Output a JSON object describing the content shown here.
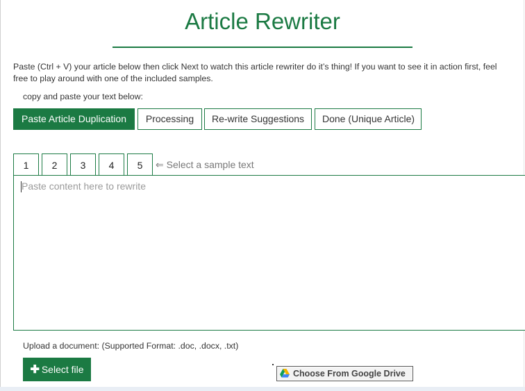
{
  "header": {
    "title": "Article Rewriter"
  },
  "intro": {
    "text": "Paste (Ctrl + V) your article below then click Next to watch this article rewriter do it’s thing! If you want to see it in action first, feel free to play around with one of the included samples.",
    "copy_label": "copy and paste your text below:"
  },
  "steps": [
    {
      "label": "Paste Article Duplication",
      "active": true
    },
    {
      "label": "Processing",
      "active": false
    },
    {
      "label": "Re-write Suggestions",
      "active": false
    },
    {
      "label": "Done (Unique Article)",
      "active": false
    }
  ],
  "samples": {
    "tabs": [
      "1",
      "2",
      "3",
      "4",
      "5"
    ],
    "hint": "⇐ Select a sample text"
  },
  "editor": {
    "placeholder": "Paste content here to rewrite",
    "value": ""
  },
  "upload": {
    "label": "Upload a document: (Supported Format: .doc, .docx, .txt)",
    "select_file_label": "Select file",
    "google_drive_label": "Choose From Google Drive"
  },
  "colors": {
    "accent": "#1b7a43",
    "text": "#333333",
    "placeholder": "#9a9a9a"
  },
  "icons": {
    "select_file": "plus-icon",
    "google_drive": "google-drive-icon",
    "hint_arrow": "left-double-arrow"
  }
}
